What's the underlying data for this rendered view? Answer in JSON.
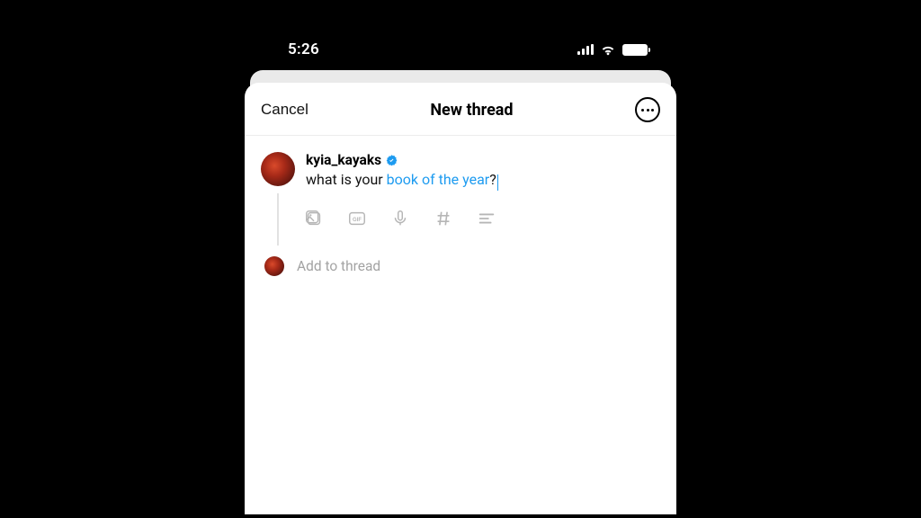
{
  "status_bar": {
    "time": "5:26"
  },
  "header": {
    "cancel": "Cancel",
    "title": "New thread"
  },
  "compose": {
    "username": "kyia_kayaks",
    "text_prefix": "what is your ",
    "text_hashtag": "book of the year",
    "text_suffix": "?"
  },
  "add_thread": {
    "label": "Add to thread"
  }
}
